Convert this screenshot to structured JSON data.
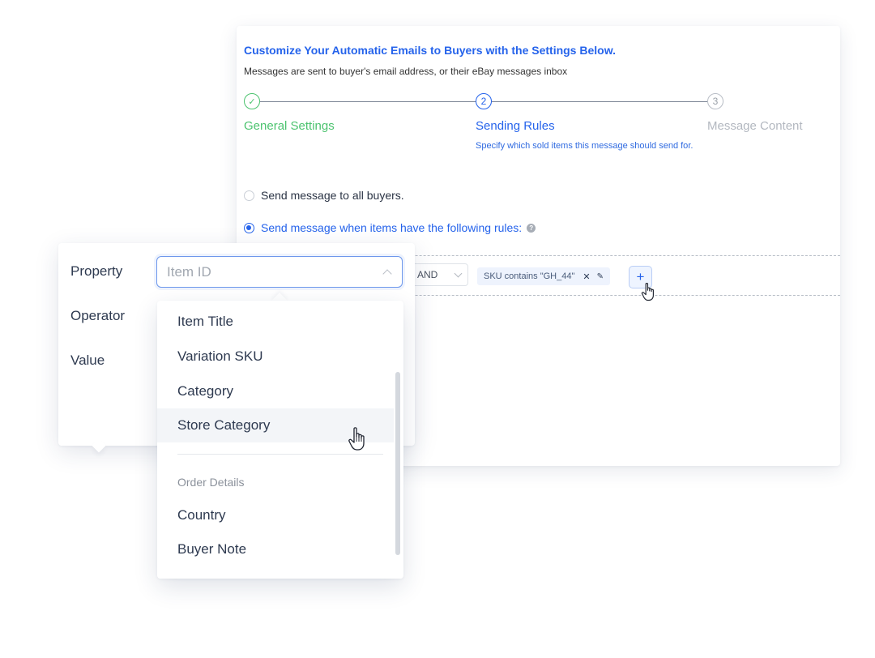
{
  "card": {
    "title": "Customize Your Automatic Emails to Buyers with the Settings Below.",
    "subtitle": "Messages are sent to buyer's email address, or their eBay messages inbox"
  },
  "stepper": {
    "steps": [
      {
        "number": "1",
        "label": "General Settings",
        "state": "completed"
      },
      {
        "number": "2",
        "label": "Sending Rules",
        "state": "active",
        "description": "Specify which sold items this message should send for."
      },
      {
        "number": "3",
        "label": "Message Content",
        "state": "upcoming"
      }
    ],
    "check_mark": "✓"
  },
  "options": {
    "all_buyers": "Send message to all buyers.",
    "rules": "Send message when items have the following rules:",
    "selected": "rules",
    "help_glyph": "?"
  },
  "rules": {
    "join_operator": "AND",
    "chips": [
      {
        "text": "SKU contains \"GH_44\""
      }
    ],
    "remove_glyph": "✕",
    "edit_glyph": "✎",
    "add_glyph": "+"
  },
  "property_panel": {
    "property_label": "Property",
    "operator_label": "Operator",
    "value_label": "Value",
    "property_placeholder": "Item ID"
  },
  "dropdown": {
    "items": [
      "Item Title",
      "Variation SKU",
      "Category",
      "Store Category"
    ],
    "hovered": "Store Category",
    "group_header": "Order Details",
    "group_items": [
      "Country",
      "Buyer Note"
    ]
  },
  "colors": {
    "accent": "#2563eb",
    "success": "#4cc36f",
    "muted": "#b3b8c0"
  }
}
